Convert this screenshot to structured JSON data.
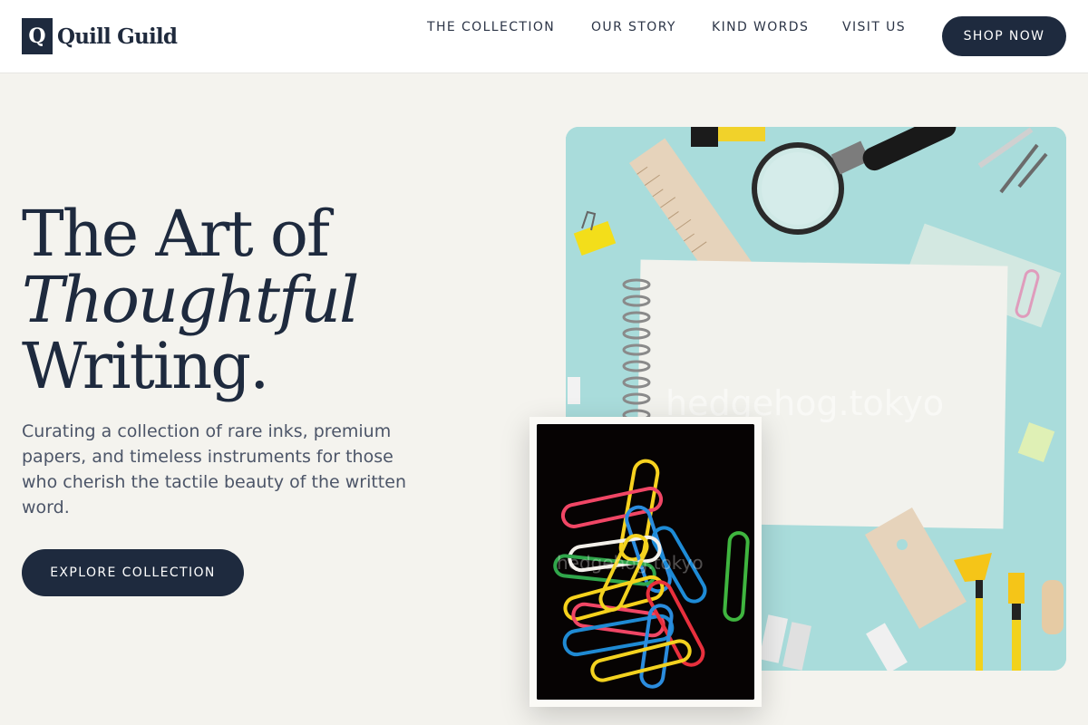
{
  "brand": {
    "mark": "Q",
    "name": "Quill Guild"
  },
  "nav": {
    "items": [
      "THE COLLECTION",
      "OUR STORY",
      "KIND WORDS",
      "VISIT US"
    ],
    "cta": "SHOP NOW"
  },
  "hero": {
    "title_line1": "The Art of",
    "title_line2": "Thoughtful",
    "title_line3": "Writing.",
    "description": "Curating a collection of rare inks, premium papers, and timeless instruments for those who cherish the tactile beauty of the written word.",
    "button": "EXPLORE COLLECTION"
  },
  "images": {
    "main_watermark": "hedgehog.tokyo",
    "inset_watermark": "hedgehog.tokyo"
  },
  "colors": {
    "background": "#f4f3ee",
    "navy": "#1e2a3e",
    "photo_bg": "#a8dcdc"
  }
}
